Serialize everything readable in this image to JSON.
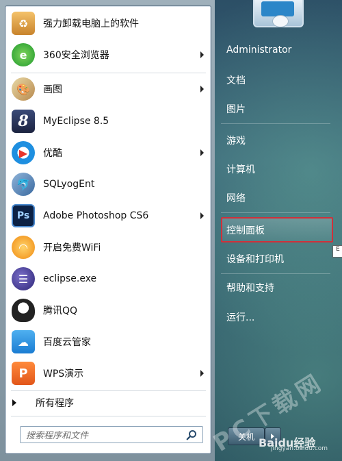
{
  "left_panel": {
    "items": [
      {
        "label": "强力卸载电脑上的软件",
        "icon": "uninstall-box-icon",
        "arrow": false
      },
      {
        "label": "360安全浏览器",
        "icon": "360-browser-icon",
        "arrow": true
      },
      {
        "label": "画图",
        "icon": "paint-palette-icon",
        "arrow": true
      },
      {
        "label": "MyEclipse 8.5",
        "icon": "myeclipse-icon",
        "arrow": false
      },
      {
        "label": "优酷",
        "icon": "youku-icon",
        "arrow": true
      },
      {
        "label": "SQLyogEnt",
        "icon": "sqlyog-dolphin-icon",
        "arrow": false
      },
      {
        "label": "Adobe Photoshop CS6",
        "icon": "photoshop-icon",
        "arrow": true
      },
      {
        "label": "开启免费WiFi",
        "icon": "wifi-icon",
        "arrow": false
      },
      {
        "label": "eclipse.exe",
        "icon": "eclipse-icon",
        "arrow": false
      },
      {
        "label": "腾讯QQ",
        "icon": "qq-penguin-icon",
        "arrow": false
      },
      {
        "label": "百度云管家",
        "icon": "baidu-cloud-icon",
        "arrow": false
      },
      {
        "label": "WPS演示",
        "icon": "wps-presentation-icon",
        "arrow": true
      }
    ],
    "all_programs": "所有程序",
    "search_placeholder": "搜索程序和文件"
  },
  "right_panel": {
    "items": [
      {
        "label": "Administrator"
      },
      {
        "label": "文档"
      },
      {
        "label": "图片"
      },
      {
        "label": "游戏"
      },
      {
        "label": "计算机"
      },
      {
        "label": "网络"
      },
      {
        "label": "控制面板",
        "highlighted": true
      },
      {
        "label": "设备和打印机"
      },
      {
        "label": "帮助和支持"
      },
      {
        "label": "运行..."
      }
    ],
    "shutdown_label": "关机"
  },
  "watermark": {
    "text1": "PC下载网",
    "text2": "Baidu经验",
    "text3": "jingyan.baidu.com"
  },
  "colors": {
    "highlight_border": "#d0303a",
    "right_panel": "#2f5869"
  }
}
